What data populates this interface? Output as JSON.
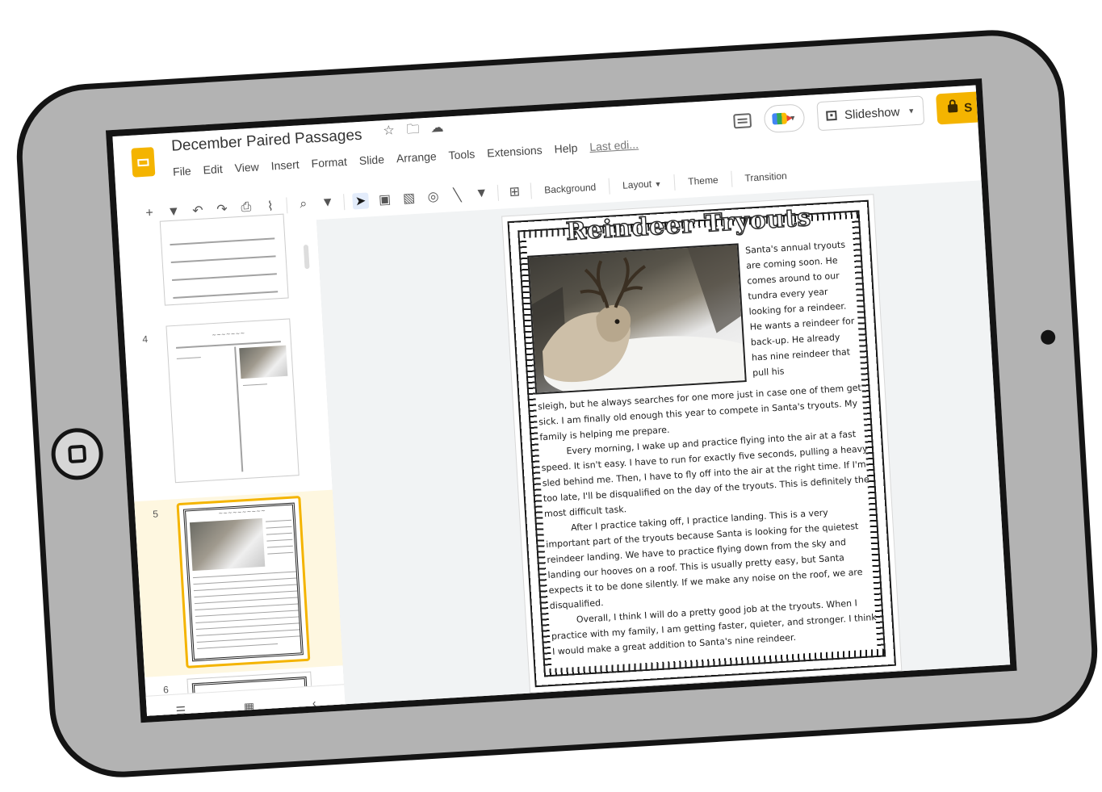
{
  "app": {
    "doc_title": "December Paired Passages",
    "title_icons": [
      "star-icon",
      "folder-icon",
      "cloud-icon"
    ],
    "menu": [
      "File",
      "Edit",
      "View",
      "Insert",
      "Format",
      "Slide",
      "Arrange",
      "Tools",
      "Extensions",
      "Help"
    ],
    "last_edit": "Last edi...",
    "slideshow_label": "Slideshow",
    "share_label": "S"
  },
  "toolbar": {
    "icons": [
      "add-icon",
      "chevron-down-icon",
      "undo-icon",
      "redo-icon",
      "print-icon",
      "paint-format-icon",
      "zoom-icon",
      "chevron-down-icon",
      "select-cursor-icon",
      "text-box-icon",
      "image-icon",
      "shape-icon",
      "line-icon",
      "comment-add-icon"
    ],
    "background_label": "Background",
    "layout_label": "Layout",
    "theme_label": "Theme",
    "transition_label": "Transition"
  },
  "filmstrip": {
    "slides": [
      {
        "number": "",
        "kind": "lined"
      },
      {
        "number": "4",
        "kind": "two-column"
      },
      {
        "number": "5",
        "kind": "reindeer",
        "active": true
      },
      {
        "number": "6",
        "kind": "partial"
      }
    ]
  },
  "slide": {
    "title": "Reindeer Tryouts",
    "side_text": "Santa's annual tryouts are coming soon. He comes around to our tundra every year looking for a reindeer. He wants a reindeer for back-up. He already has nine reindeer that pull his",
    "paragraphs": [
      "sleigh, but he always searches for one more just in case one of them get sick. I am finally old enough this year to compete in Santa's tryouts. My family is helping me prepare.",
      "Every morning, I wake up and practice flying into the air at a fast speed. It isn't easy. I have to run for exactly five seconds, pulling a heavy sled behind me. Then, I have to fly off into the air at the right time. If I'm too late, I'll be disqualified on the day of the tryouts. This is definitely the most difficult task.",
      "After I practice taking off, I practice landing. This is a very important part of the tryouts because Santa is looking for the quietest reindeer landing. We have to practice flying down from the sky and landing our hooves on a roof. This is usually pretty easy, but Santa expects it to be done silently. If we make any noise on the roof, we are disqualified.",
      "Overall, I think I will do a pretty good job at the tryouts. When I practice with my family, I am getting faster, quieter, and stronger. I think I would make a great addition to Santa's nine reindeer."
    ]
  },
  "colors": {
    "tablet_body": "#b3b3b3",
    "bezel": "#141414",
    "accent": "#f4b400",
    "active_thumb_bg": "#fef7e0"
  }
}
